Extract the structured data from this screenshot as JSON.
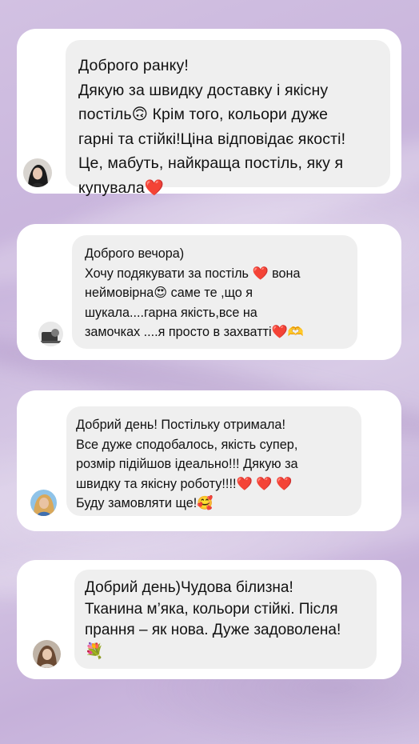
{
  "reviews": [
    {
      "avatar_icon": "woman-portrait-dark-hair",
      "lines": [
        "Доброго ранку!",
        "Дякую за швидку доставку і якісну",
        "постіль🙃 Крім того, кольори дуже",
        "гарні та стійкі!Ціна відповідає якості!",
        "Це, мабуть, найкраща постіль, яку я",
        "купувала❤️"
      ]
    },
    {
      "avatar_icon": "person-with-laptop",
      "lines": [
        "Доброго вечора)",
        "Хочу подякувати за постіль ❤️ вона",
        "неймовірна😍 саме те ,що я",
        "шукала....гарна якість,все на",
        "замочках ....я просто в захватті❤️🫶"
      ]
    },
    {
      "avatar_icon": "woman-blonde-portrait",
      "lines": [
        "Добрий день! Постільку отримала!",
        "Все дуже сподобалось, якість супер,",
        "розмір підійшов ідеально!!! Дякую за",
        "швидку та якісну роботу!!!!❤️ ❤️ ❤️",
        "Буду замовляти ще!🥰"
      ]
    },
    {
      "avatar_icon": "woman-brown-hair-portrait",
      "lines": [
        "Добрий день)Чудова білизна!",
        "Тканина м’яка, кольори стійкі. Після",
        "прання – як нова. Дуже задоволена!",
        "💐"
      ]
    }
  ]
}
